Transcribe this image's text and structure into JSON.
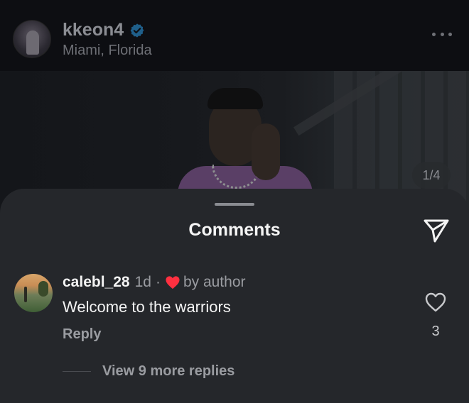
{
  "post": {
    "username": "kkeon4",
    "location": "Miami, Florida",
    "page_indicator": "1/4",
    "verified_color": "#0095f6"
  },
  "sheet": {
    "title": "Comments"
  },
  "comment": {
    "username": "calebl_28",
    "time": "1d",
    "separator": "·",
    "liked_by": "by author",
    "text": "Welcome to the warriors",
    "reply_label": "Reply",
    "like_count": "3",
    "heart_color": "#ff3040"
  },
  "replies": {
    "label": "View 9 more replies"
  }
}
